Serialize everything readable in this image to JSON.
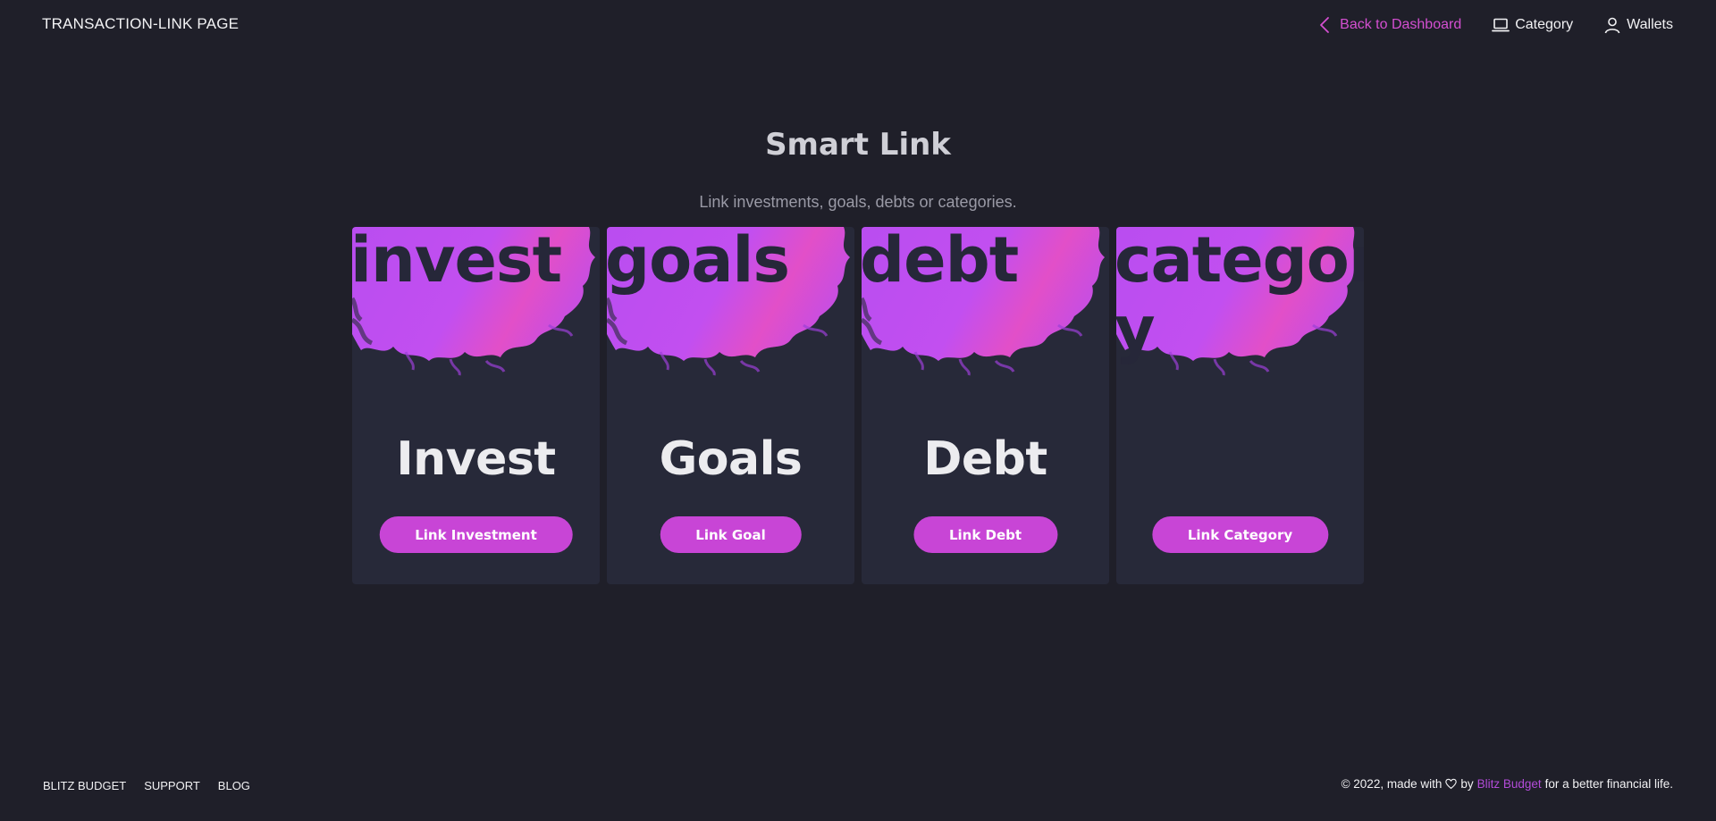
{
  "header": {
    "title": "TRANSACTION-LINK PAGE",
    "nav": [
      {
        "label": "Back to Dashboard",
        "icon": "chevron-left-icon"
      },
      {
        "label": "Category",
        "icon": "laptop-icon"
      },
      {
        "label": "Wallets",
        "icon": "user-icon"
      }
    ]
  },
  "main": {
    "title": "Smart Link",
    "subtitle": "Link investments, goals, debts or categories."
  },
  "cards": [
    {
      "art_word": "invest",
      "label": "Invest",
      "button": "Link Investment"
    },
    {
      "art_word": "goals",
      "label": "Goals",
      "button": "Link Goal"
    },
    {
      "art_word": "debt",
      "label": "Debt",
      "button": "Link Debt"
    },
    {
      "art_word": "category",
      "label": "",
      "button": "Link Category"
    }
  ],
  "footer": {
    "links": [
      "BLITZ BUDGET",
      "SUPPORT",
      "BLOG"
    ],
    "copyright_prefix": "© 2022, made with",
    "copyright_by": "by",
    "brand_link": "Blitz Budget",
    "copyright_suffix": "for a better financial life."
  },
  "colors": {
    "background": "#1f1f29",
    "card": "#272939",
    "accent": "#c845d6",
    "nav_accent": "#d44fd1",
    "smoke_purple": "#b94df0",
    "smoke_pink": "#e24fc8"
  }
}
